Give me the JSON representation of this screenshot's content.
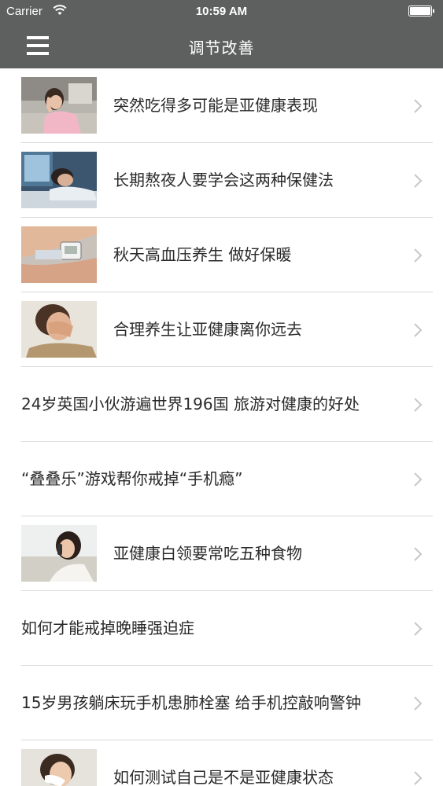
{
  "status_bar": {
    "carrier": "Carrier",
    "time": "10:59 AM"
  },
  "nav": {
    "title": "调节改善",
    "menu_icon": "hamburger-menu-icon"
  },
  "articles": [
    {
      "title": "突然吃得多可能是亚健康表现",
      "thumbnail": "woman-headache-desk"
    },
    {
      "title": "长期熬夜人要学会这两种保健法",
      "thumbnail": "man-asleep-at-computer"
    },
    {
      "title": "秋天高血压养生 做好保暖",
      "thumbnail": "blood-pressure-monitor"
    },
    {
      "title": "合理养生让亚健康离你远去",
      "thumbnail": "tired-woman-rubbing-eyes"
    },
    {
      "title": "24岁英国小伙游遍世界196国 旅游对健康的好处",
      "thumbnail": null
    },
    {
      "title": "“叠叠乐”游戏帮你戒掉“手机瘾”",
      "thumbnail": null
    },
    {
      "title": "亚健康白领要常吃五种食物",
      "thumbnail": "woman-on-phone"
    },
    {
      "title": "如何才能戒掉晚睡强迫症",
      "thumbnail": null
    },
    {
      "title": "15岁男孩躺床玩手机患肺栓塞 给手机控敲响警钟",
      "thumbnail": null
    },
    {
      "title": "如何测试自己是不是亚健康状态",
      "thumbnail": "woman-sneezing"
    }
  ]
}
